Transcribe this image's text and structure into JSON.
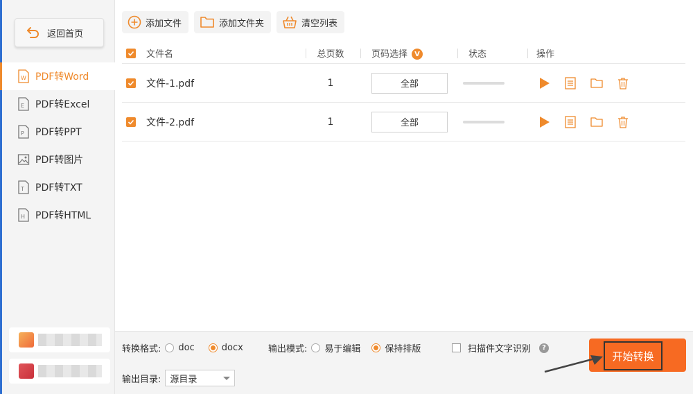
{
  "sidebar": {
    "back_label": "返回首页",
    "items": [
      {
        "label": "PDF转Word",
        "icon": "word-doc-icon"
      },
      {
        "label": "PDF转Excel",
        "icon": "excel-doc-icon"
      },
      {
        "label": "PDF转PPT",
        "icon": "ppt-doc-icon"
      },
      {
        "label": "PDF转图片",
        "icon": "image-doc-icon"
      },
      {
        "label": "PDF转TXT",
        "icon": "txt-doc-icon"
      },
      {
        "label": "PDF转HTML",
        "icon": "html-doc-icon"
      }
    ],
    "active_index": 0
  },
  "toolbar": {
    "add_file": "添加文件",
    "add_folder": "添加文件夹",
    "clear_list": "清空列表"
  },
  "table": {
    "headers": {
      "name": "文件名",
      "pages": "总页数",
      "range": "页码选择",
      "status": "状态",
      "ops": "操作"
    },
    "range_badge": "V",
    "rows": [
      {
        "name": "文件-1.pdf",
        "pages": "1",
        "range": "全部"
      },
      {
        "name": "文件-2.pdf",
        "pages": "1",
        "range": "全部"
      }
    ]
  },
  "bottom": {
    "format_label": "转换格式:",
    "format_options": [
      "doc",
      "docx"
    ],
    "format_selected": "docx",
    "mode_label": "输出模式:",
    "mode_options": [
      "易于编辑",
      "保持排版"
    ],
    "mode_selected": "保持排版",
    "ocr_label": "扫描件文字识别",
    "help_mark": "?",
    "output_label": "输出目录:",
    "output_value": "源目录",
    "start_label": "开始转换"
  },
  "colors": {
    "accent": "#ef8a2c",
    "start_button": "#f76a22",
    "sidebar_bg": "#f4f4f4"
  }
}
